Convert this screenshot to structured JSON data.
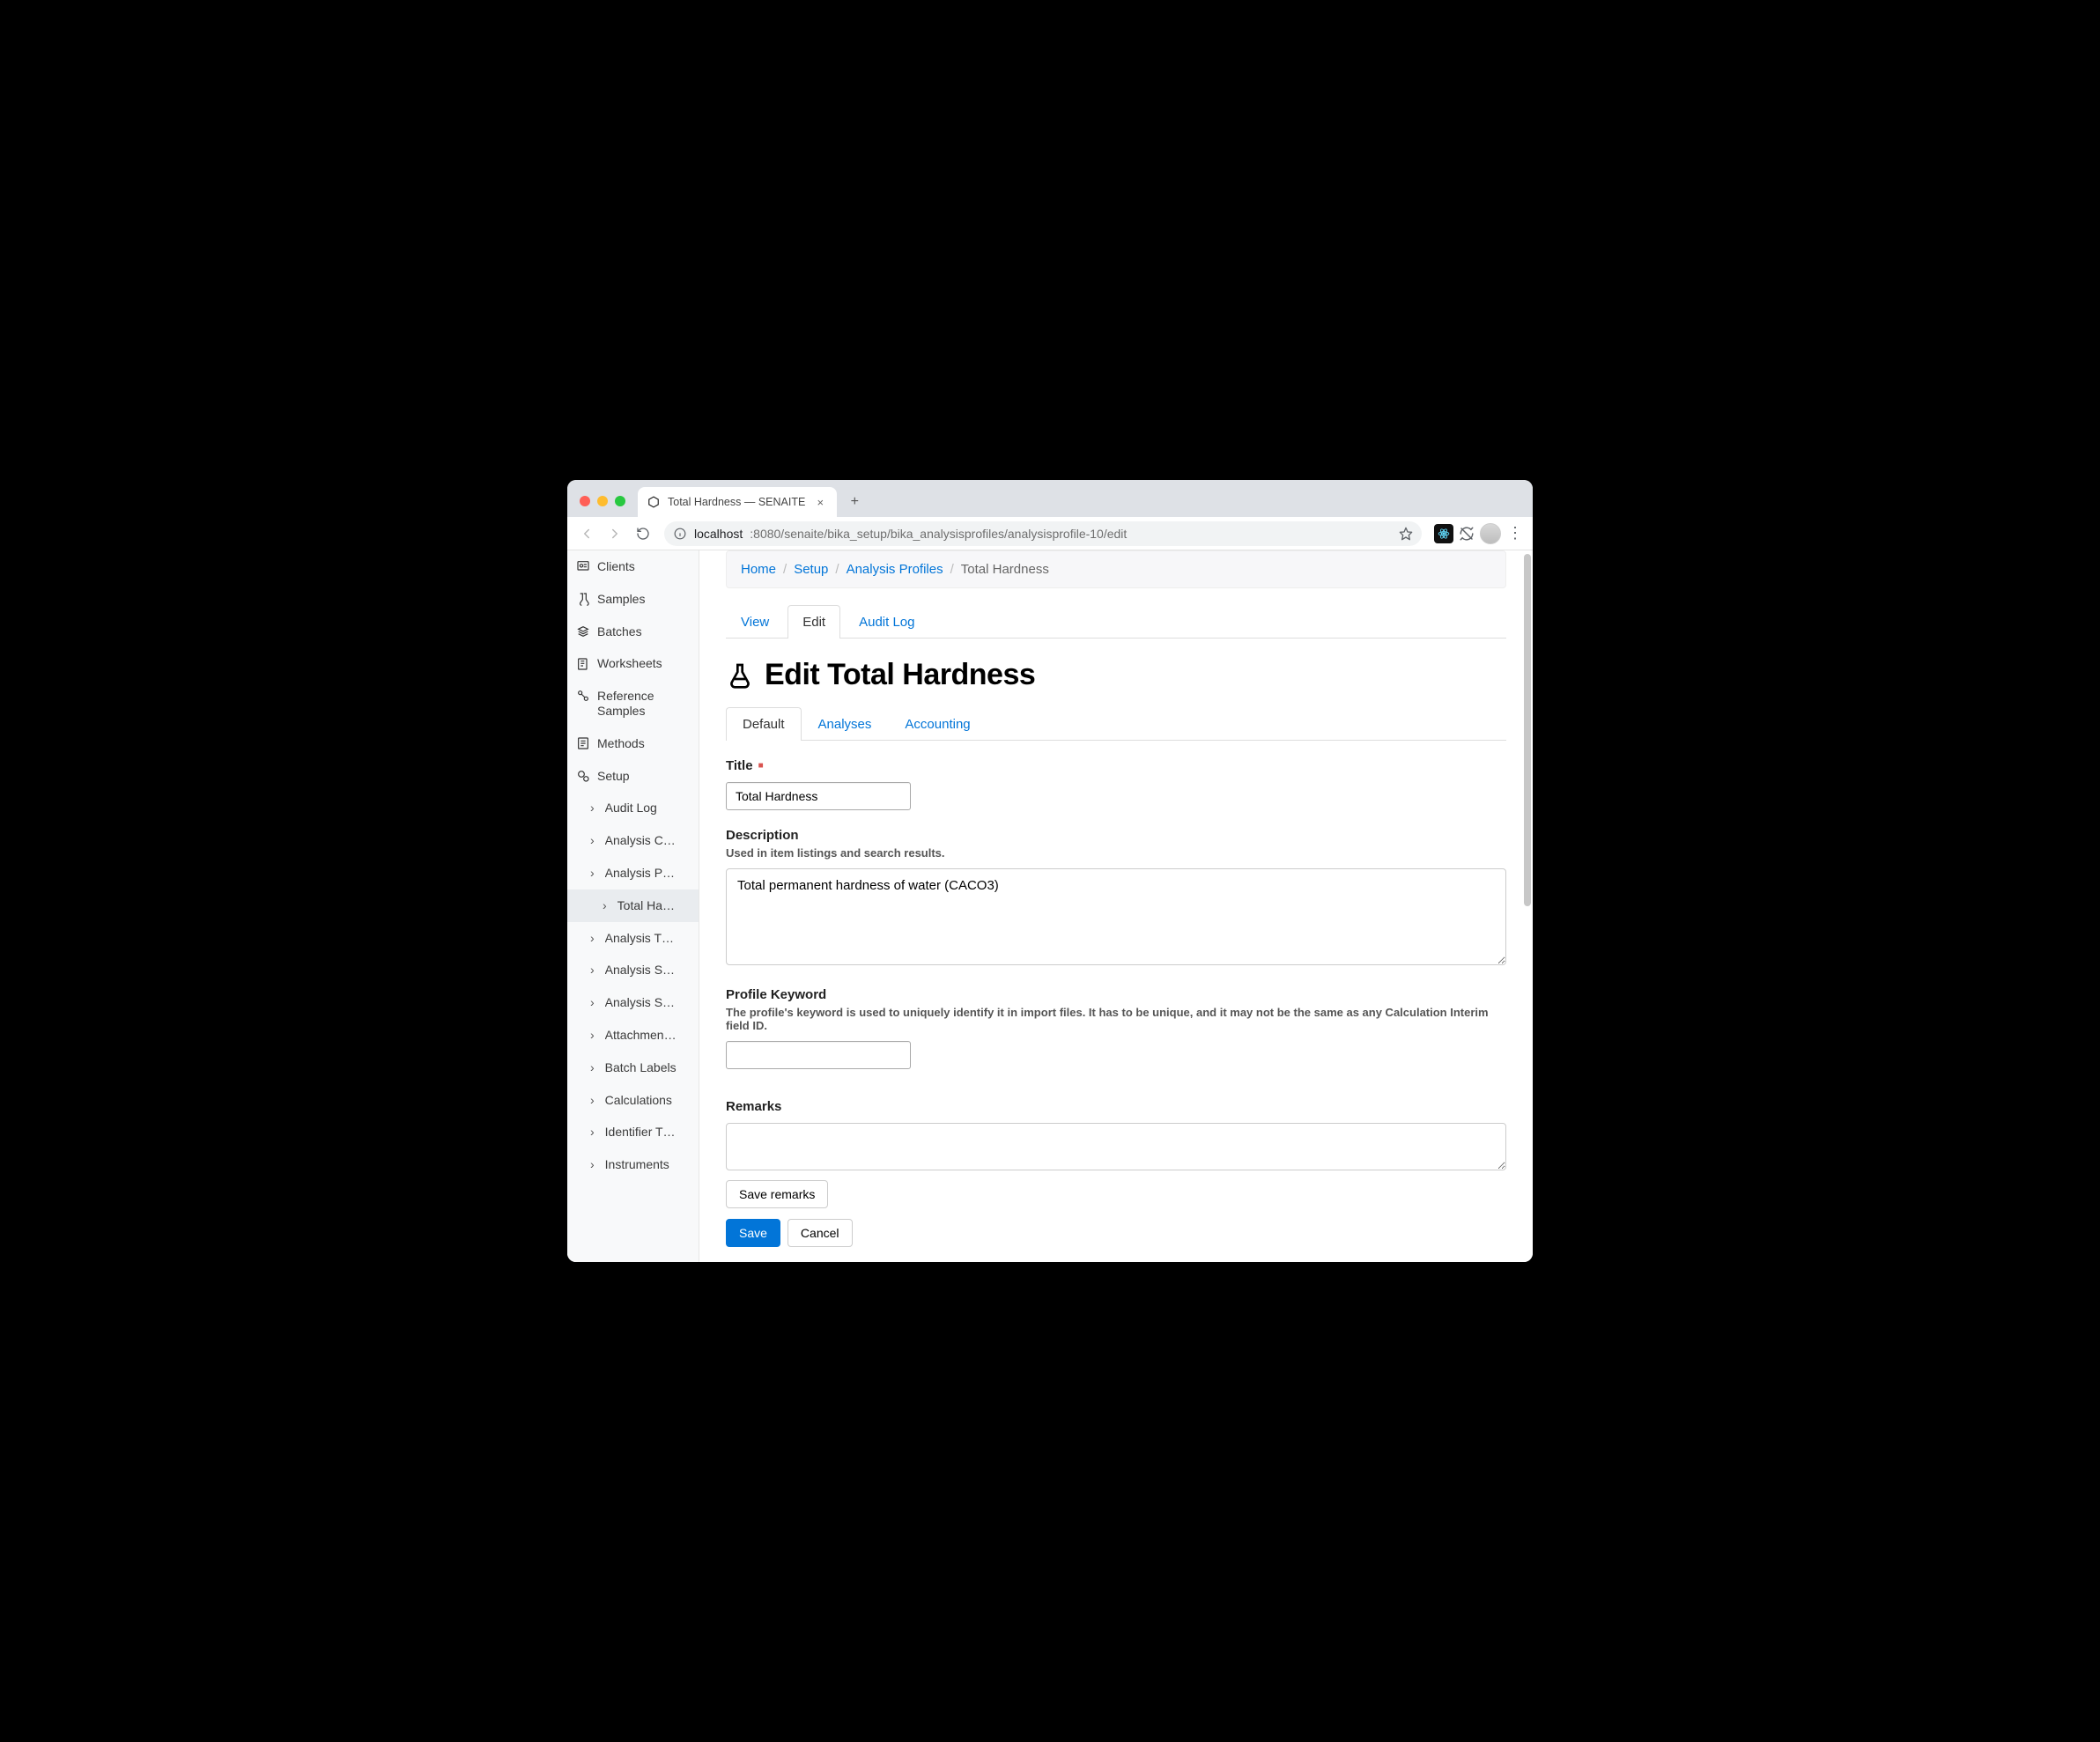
{
  "browser": {
    "tab_title": "Total Hardness — SENAITE",
    "url_host": "localhost",
    "url_path": ":8080/senaite/bika_setup/bika_analysisprofiles/analysisprofile-10/edit"
  },
  "sidebar": {
    "items": [
      {
        "label": "Clients"
      },
      {
        "label": "Samples"
      },
      {
        "label": "Batches"
      },
      {
        "label": "Worksheets"
      },
      {
        "label": "Reference Samples"
      },
      {
        "label": "Methods"
      },
      {
        "label": "Setup"
      }
    ],
    "setup_children": [
      {
        "label": "Audit Log"
      },
      {
        "label": "Analysis C…"
      },
      {
        "label": "Analysis P…"
      },
      {
        "label": "Total Ha…",
        "active": true,
        "depth": 2
      },
      {
        "label": "Analysis T…"
      },
      {
        "label": "Analysis S…"
      },
      {
        "label": "Analysis S…"
      },
      {
        "label": "Attachmen…"
      },
      {
        "label": "Batch Labels"
      },
      {
        "label": "Calculations"
      },
      {
        "label": "Identifier T…"
      },
      {
        "label": "Instruments"
      }
    ]
  },
  "breadcrumbs": [
    {
      "label": "Home",
      "link": true
    },
    {
      "label": "Setup",
      "link": true
    },
    {
      "label": "Analysis Profiles",
      "link": true
    },
    {
      "label": "Total Hardness",
      "link": false
    }
  ],
  "tabs": {
    "items": [
      {
        "label": "View"
      },
      {
        "label": "Edit",
        "active": true
      },
      {
        "label": "Audit Log"
      }
    ]
  },
  "page": {
    "heading": "Edit Total Hardness"
  },
  "subtabs": {
    "items": [
      {
        "label": "Default",
        "active": true
      },
      {
        "label": "Analyses"
      },
      {
        "label": "Accounting"
      }
    ]
  },
  "form": {
    "title_label": "Title",
    "title_value": "Total Hardness",
    "description_label": "Description",
    "description_help": "Used in item listings and search results.",
    "description_value": "Total permanent hardness of water (CACO3)",
    "keyword_label": "Profile Keyword",
    "keyword_help": "The profile's keyword is used to uniquely identify it in import files. It has to be unique, and it may not be the same as any Calculation Interim field ID.",
    "keyword_value": "",
    "remarks_label": "Remarks",
    "remarks_value": "",
    "save_remarks_label": "Save remarks",
    "save_label": "Save",
    "cancel_label": "Cancel"
  }
}
